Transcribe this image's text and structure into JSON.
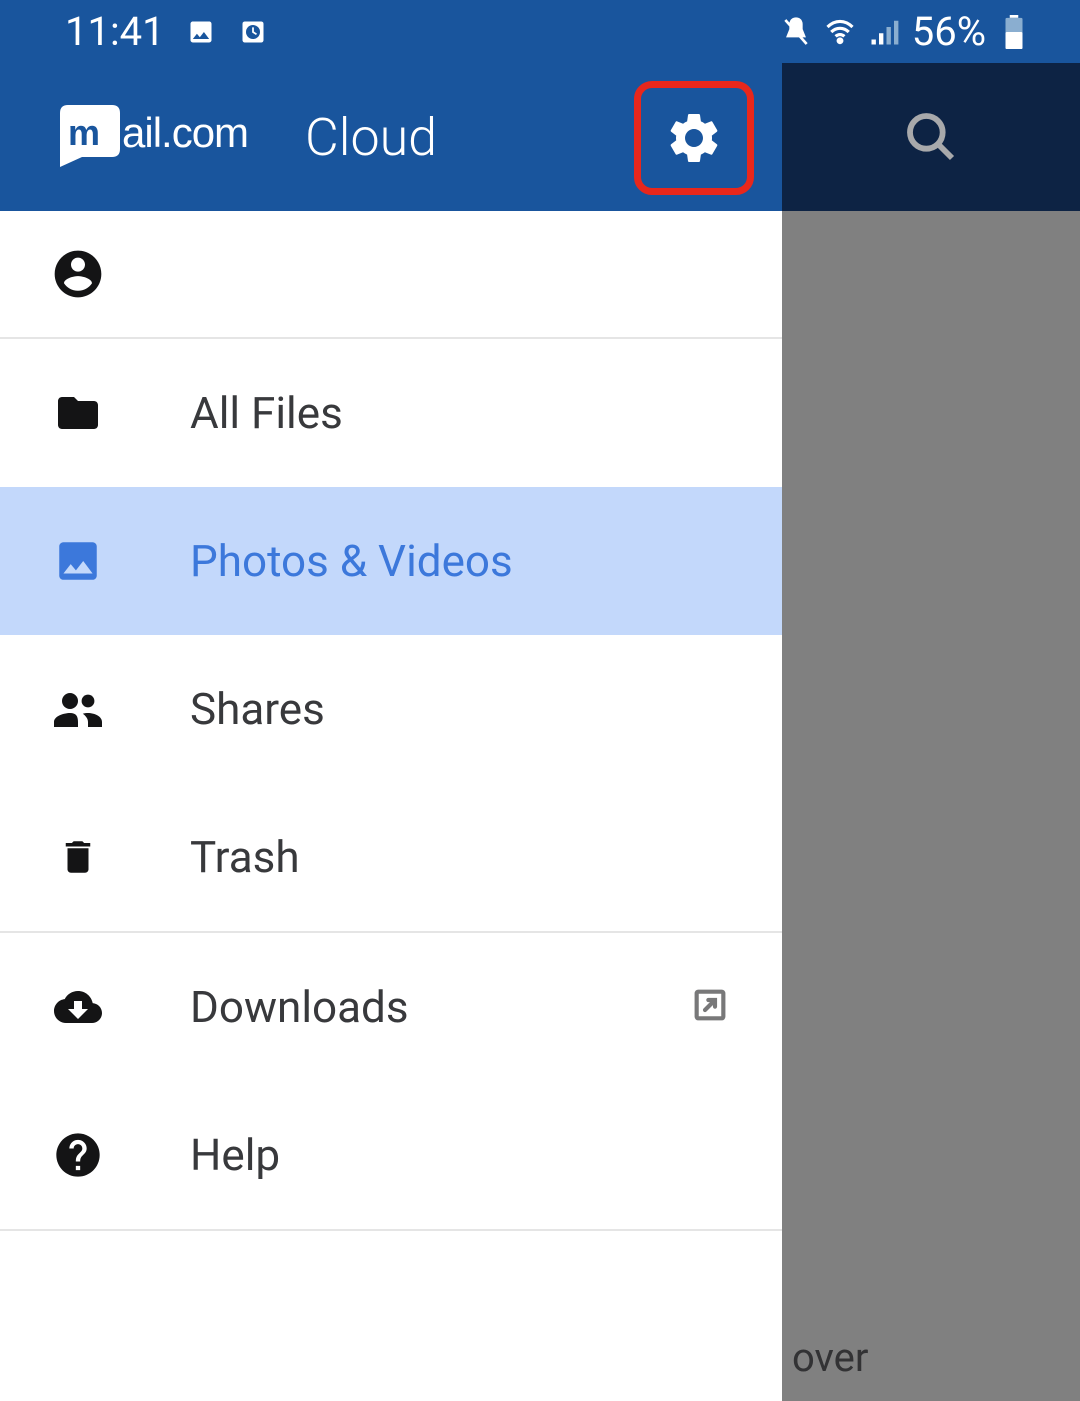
{
  "status": {
    "time": "11:41",
    "battery": "56%"
  },
  "header": {
    "logo_letter": "m",
    "logo_text": "ail.com",
    "subtitle": "Cloud"
  },
  "nav": {
    "items": [
      {
        "label": "All Files",
        "icon": "folder",
        "selected": false
      },
      {
        "label": "Photos & Videos",
        "icon": "image",
        "selected": true
      },
      {
        "label": "Shares",
        "icon": "people",
        "selected": false
      },
      {
        "label": "Trash",
        "icon": "trash",
        "selected": false
      }
    ],
    "secondary": [
      {
        "label": "Downloads",
        "icon": "cloud-download",
        "trailing": "open-external"
      },
      {
        "label": "Help",
        "icon": "help"
      }
    ]
  },
  "scrim": {
    "text": "over"
  }
}
